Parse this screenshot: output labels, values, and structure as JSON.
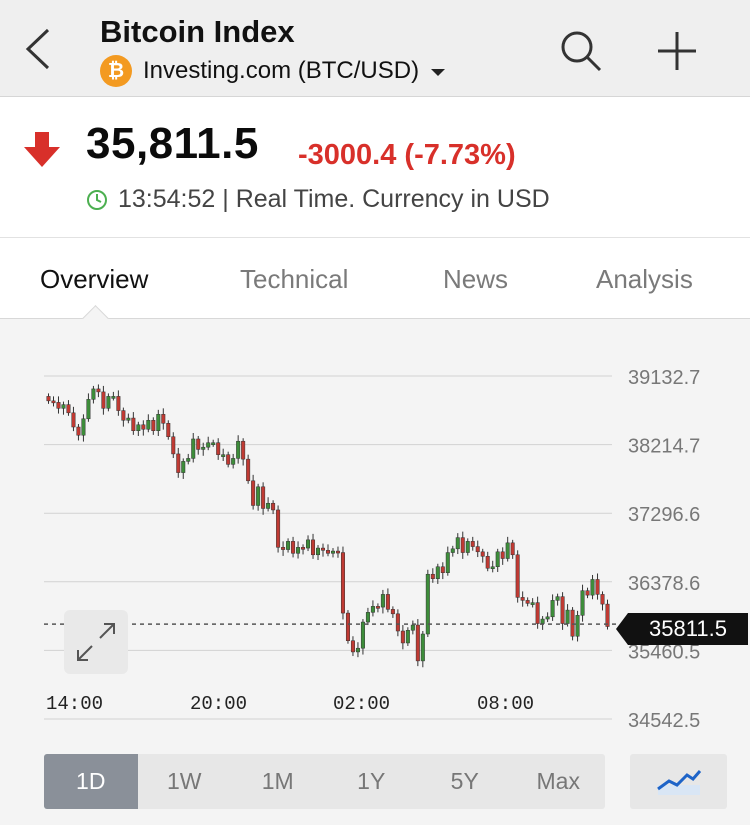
{
  "header": {
    "title": "Bitcoin Index",
    "source": "Investing.com (BTC/USD)",
    "coin_symbol": "₿"
  },
  "quote": {
    "price": "35,811.5",
    "change": "-3000.4 (-7.73%)",
    "time": "13:54:52 | Real Time. Currency in USD",
    "down_color": "#d8302a"
  },
  "tabs": [
    {
      "label": "Overview",
      "active": true
    },
    {
      "label": "Technical",
      "active": false
    },
    {
      "label": "News",
      "active": false
    },
    {
      "label": "Analysis",
      "active": false
    }
  ],
  "current_price_tag": "35811.5",
  "ranges": [
    {
      "label": "1D",
      "active": true
    },
    {
      "label": "1W",
      "active": false
    },
    {
      "label": "1M",
      "active": false
    },
    {
      "label": "1Y",
      "active": false
    },
    {
      "label": "5Y",
      "active": false
    },
    {
      "label": "Max",
      "active": false
    }
  ],
  "chart_data": {
    "type": "candlestick",
    "title": "",
    "xlabel": "",
    "ylabel": "",
    "ylim": [
      34542.5,
      39132.7
    ],
    "yticks": [
      39132.7,
      38214.7,
      37296.6,
      36378.6,
      35460.5,
      34542.5
    ],
    "ytick_labels": [
      "39132.7",
      "38214.7",
      "37296.6",
      "36378.6",
      "35460.5",
      "34542.5"
    ],
    "xticks": [
      "14:00",
      "20:00",
      "02:00",
      "08:00"
    ],
    "current_price": 35811.5,
    "up_color": "#3d8d3a",
    "down_color": "#c03a33",
    "grid": true,
    "closes": [
      38800,
      38780,
      38700,
      38750,
      38640,
      38450,
      38340,
      38560,
      38820,
      38960,
      38920,
      38700,
      38860,
      38860,
      38670,
      38540,
      38570,
      38400,
      38480,
      38420,
      38540,
      38400,
      38620,
      38500,
      38320,
      38090,
      37840,
      37990,
      38030,
      38290,
      38150,
      38180,
      38240,
      38240,
      38080,
      38080,
      37950,
      38030,
      38260,
      38020,
      37730,
      37400,
      37650,
      37360,
      37430,
      37340,
      36840,
      36810,
      36920,
      36760,
      36840,
      36830,
      36940,
      36740,
      36830,
      36800,
      36760,
      36790,
      36770,
      35960,
      35590,
      35440,
      35490,
      35840,
      35970,
      36050,
      36040,
      36210,
      36010,
      35950,
      35720,
      35560,
      35730,
      35800,
      35320,
      35680,
      36480,
      36420,
      36580,
      36500,
      36770,
      36820,
      36970,
      36770,
      36920,
      36850,
      36780,
      36720,
      36560,
      36580,
      36780,
      36690,
      36900,
      36740,
      36170,
      36130,
      36090,
      36100,
      35820,
      35880,
      35910,
      36130,
      36180,
      35820,
      36000,
      35650,
      35930,
      36260,
      36200,
      36410,
      36210,
      36080,
      35780
    ],
    "note": "Candlestick series read approximately from the image; 113 five-minute-ish bars spanning ~13:00 to ~13:55 next day."
  }
}
